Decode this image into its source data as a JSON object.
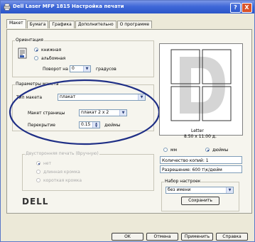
{
  "window": {
    "title": "Dell Laser MFP 1815 Настройка печати",
    "help_glyph": "?",
    "close_glyph": "X",
    "app_icon": "printer-icon"
  },
  "tabs": [
    {
      "label": "Макет",
      "active": true
    },
    {
      "label": "Бумага",
      "active": false
    },
    {
      "label": "Графика",
      "active": false
    },
    {
      "label": "Дополнительно",
      "active": false
    },
    {
      "label": "О программе",
      "active": false
    }
  ],
  "orientation": {
    "title": "Ориентация",
    "portrait_label": "книжная",
    "landscape_label": "альбомная",
    "portrait_selected": true,
    "rotate_label": "Поворот на",
    "rotate_value": "0",
    "rotate_unit": "градусов"
  },
  "layout": {
    "title": "Параметры макета",
    "type_label": "Тип макета",
    "type_value": "плакат",
    "page_layout_label": "Макет страницы",
    "page_layout_value": "плакат 2 x 2",
    "overlap_label": "Перекрытие",
    "overlap_value": "0.15",
    "overlap_unit": "дюймы"
  },
  "duplex": {
    "title": "Двусторонняя печать (Вручную)",
    "options": [
      "нет",
      "длинная кромка",
      "короткая кромка"
    ],
    "selected_index": 0
  },
  "logo": {
    "text": "DELL"
  },
  "preview": {
    "paper_name": "Letter",
    "paper_size": "8.50 x 11.00 д."
  },
  "units": {
    "mm_label": "мм",
    "inch_label": "дюймы",
    "inch_selected": true
  },
  "info": {
    "copies": "Количество копий: 1",
    "resolution": "Разрешение: 600 т\\к/дюйм"
  },
  "favorites": {
    "title": "Набор настроек",
    "value": "без имени",
    "save_label": "Сохранить"
  },
  "buttons": {
    "ok": "OK",
    "cancel": "Отмена",
    "apply": "Применить",
    "help": "Справка"
  },
  "annotation": {
    "color": "#1f2f86"
  },
  "colors": {
    "titlebar": "#3f68d8",
    "dialog_bg": "#ece9d8"
  }
}
